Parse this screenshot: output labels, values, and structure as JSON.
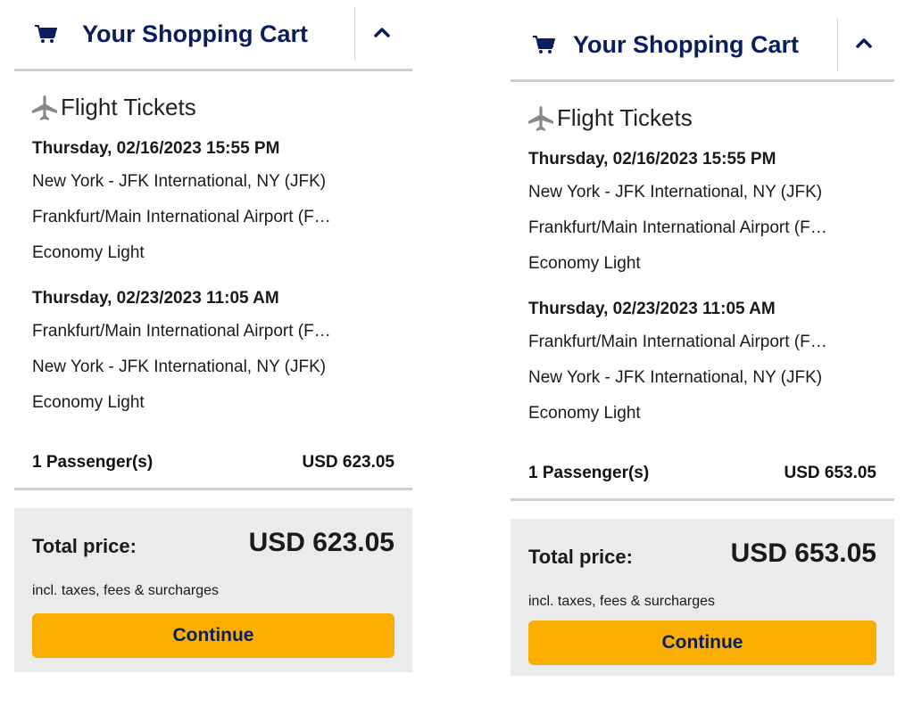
{
  "panels": [
    {
      "header": {
        "title": "Your Shopping Cart",
        "cart_icon": "shopping-cart-icon",
        "collapse_icon": "chevron-up-icon"
      },
      "section": {
        "title": "Flight Tickets",
        "icon": "airplane-icon"
      },
      "flights": [
        {
          "date": "Thursday, 02/16/2023 15:55 PM",
          "origin": "New York - JFK International, NY (JFK)",
          "destination": "Frankfurt/Main International Airport (F…",
          "fare": "Economy Light"
        },
        {
          "date": "Thursday, 02/23/2023 11:05 AM",
          "origin": "Frankfurt/Main International Airport (F…",
          "destination": "New York - JFK International, NY (JFK)",
          "fare": "Economy Light"
        }
      ],
      "passengers": {
        "label": "1 Passenger(s)",
        "price": "USD 623.05"
      },
      "total": {
        "label": "Total price:",
        "value": "USD 623.05",
        "note": "incl. taxes, fees & surcharges",
        "button": "Continue"
      }
    },
    {
      "header": {
        "title": "Your Shopping Cart",
        "cart_icon": "shopping-cart-icon",
        "collapse_icon": "chevron-up-icon"
      },
      "section": {
        "title": "Flight Tickets",
        "icon": "airplane-icon"
      },
      "flights": [
        {
          "date": "Thursday, 02/16/2023 15:55 PM",
          "origin": "New York - JFK International, NY (JFK)",
          "destination": "Frankfurt/Main International Airport (F…",
          "fare": "Economy Light"
        },
        {
          "date": "Thursday, 02/23/2023 11:05 AM",
          "origin": "Frankfurt/Main International Airport (F…",
          "destination": "New York - JFK International, NY (JFK)",
          "fare": "Economy Light"
        }
      ],
      "passengers": {
        "label": "1 Passenger(s)",
        "price": "USD 653.05"
      },
      "total": {
        "label": "Total price:",
        "value": "USD 653.05",
        "note": "incl. taxes, fees & surcharges",
        "button": "Continue"
      }
    }
  ],
  "colors": {
    "title_navy": "#0a1d5c",
    "button_yellow": "#f9ae00",
    "total_bg": "#ebebeb",
    "divider": "#cfcfcf",
    "icon_gray": "#888888"
  }
}
